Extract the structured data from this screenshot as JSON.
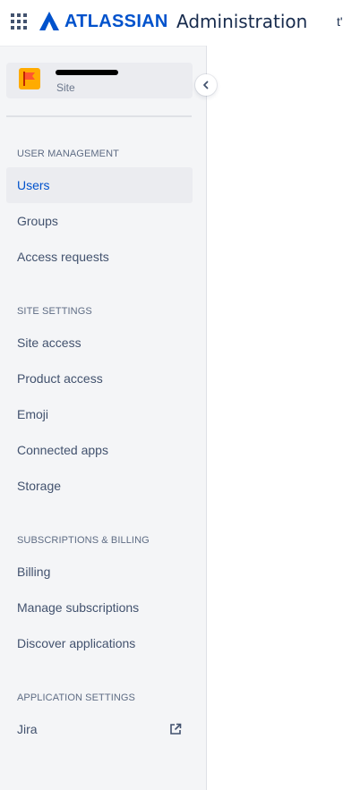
{
  "topbar": {
    "brand": "ATLASSIAN",
    "product": "Administration",
    "overflow_text": "t'",
    "icons": {
      "app_switcher": "grid-icon",
      "logo": "atlassian-logo-icon"
    },
    "brand_color": "#0052CC"
  },
  "site": {
    "name": "",
    "type_label": "Site",
    "icon": "flag-icon",
    "icon_color": "#FFAB00",
    "flag_color": "#FF5630"
  },
  "sidebar": {
    "collapse_icon": "chevron-left-icon",
    "sections": [
      {
        "heading": "USER MANAGEMENT",
        "items": [
          {
            "label": "Users",
            "active": true
          },
          {
            "label": "Groups"
          },
          {
            "label": "Access requests"
          }
        ]
      },
      {
        "heading": "SITE SETTINGS",
        "items": [
          {
            "label": "Site access"
          },
          {
            "label": "Product access"
          },
          {
            "label": "Emoji"
          },
          {
            "label": "Connected apps"
          },
          {
            "label": "Storage"
          }
        ]
      },
      {
        "heading": "SUBSCRIPTIONS & BILLING",
        "items": [
          {
            "label": "Billing"
          },
          {
            "label": "Manage subscriptions"
          },
          {
            "label": "Discover applications"
          }
        ]
      },
      {
        "heading": "APPLICATION SETTINGS",
        "items": [
          {
            "label": "Jira",
            "icon": "external-link-icon"
          }
        ]
      }
    ]
  }
}
